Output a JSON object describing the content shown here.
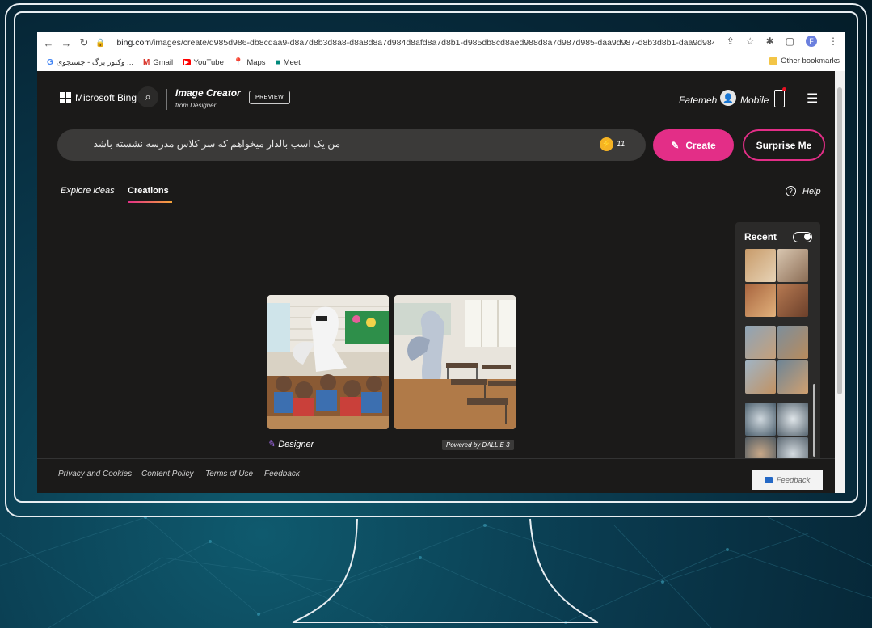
{
  "browser": {
    "url_host": "bing.com",
    "url_path": "/images/create/d985d986-db8cdaa9-d8a7d8b3d8a8-d8a8d8a7d984d8afd8a7d8b1-d985db8cd8aed988d8a7d987d985-daa9d987-d8b3d8b1-daa9d984d...",
    "bookmarks": [
      {
        "label": "وکتور برگ - جستجوی ...",
        "icon": "google-icon",
        "color": "#4285f4"
      },
      {
        "label": "Gmail",
        "icon": "gmail-icon",
        "color": "#d93025"
      },
      {
        "label": "YouTube",
        "icon": "youtube-icon",
        "color": "#ff0000"
      },
      {
        "label": "Maps",
        "icon": "maps-icon",
        "color": "#34a853"
      },
      {
        "label": "Meet",
        "icon": "meet-icon",
        "color": "#00897b"
      }
    ],
    "other_bookmarks": "Other bookmarks",
    "profile_initial": "F"
  },
  "header": {
    "brand": "Microsoft Bing",
    "product_title": "Image Creator",
    "product_sub": "from Designer",
    "preview_badge": "PREVIEW",
    "user_name": "Fatemeh",
    "mobile_label": "Mobile"
  },
  "prompt": {
    "text": "من یک اسب بالدار میخواهم که سر کلاس مدرسه نشسته باشد",
    "coins": "11",
    "create_label": "Create",
    "surprise_label": "Surprise Me"
  },
  "tabs": {
    "explore": "Explore ideas",
    "creations": "Creations",
    "help": "Help"
  },
  "results": {
    "designer_label": "Designer",
    "powered_label": "Powered by DALL E 3"
  },
  "recent": {
    "title": "Recent"
  },
  "footer": {
    "links": [
      "Privacy and Cookies",
      "Content Policy",
      "Terms of Use",
      "Feedback"
    ],
    "feedback_button": "Feedback"
  },
  "colors": {
    "accent": "#e32e87",
    "page_bg": "#1b1a19",
    "coin": "#f5b324"
  }
}
